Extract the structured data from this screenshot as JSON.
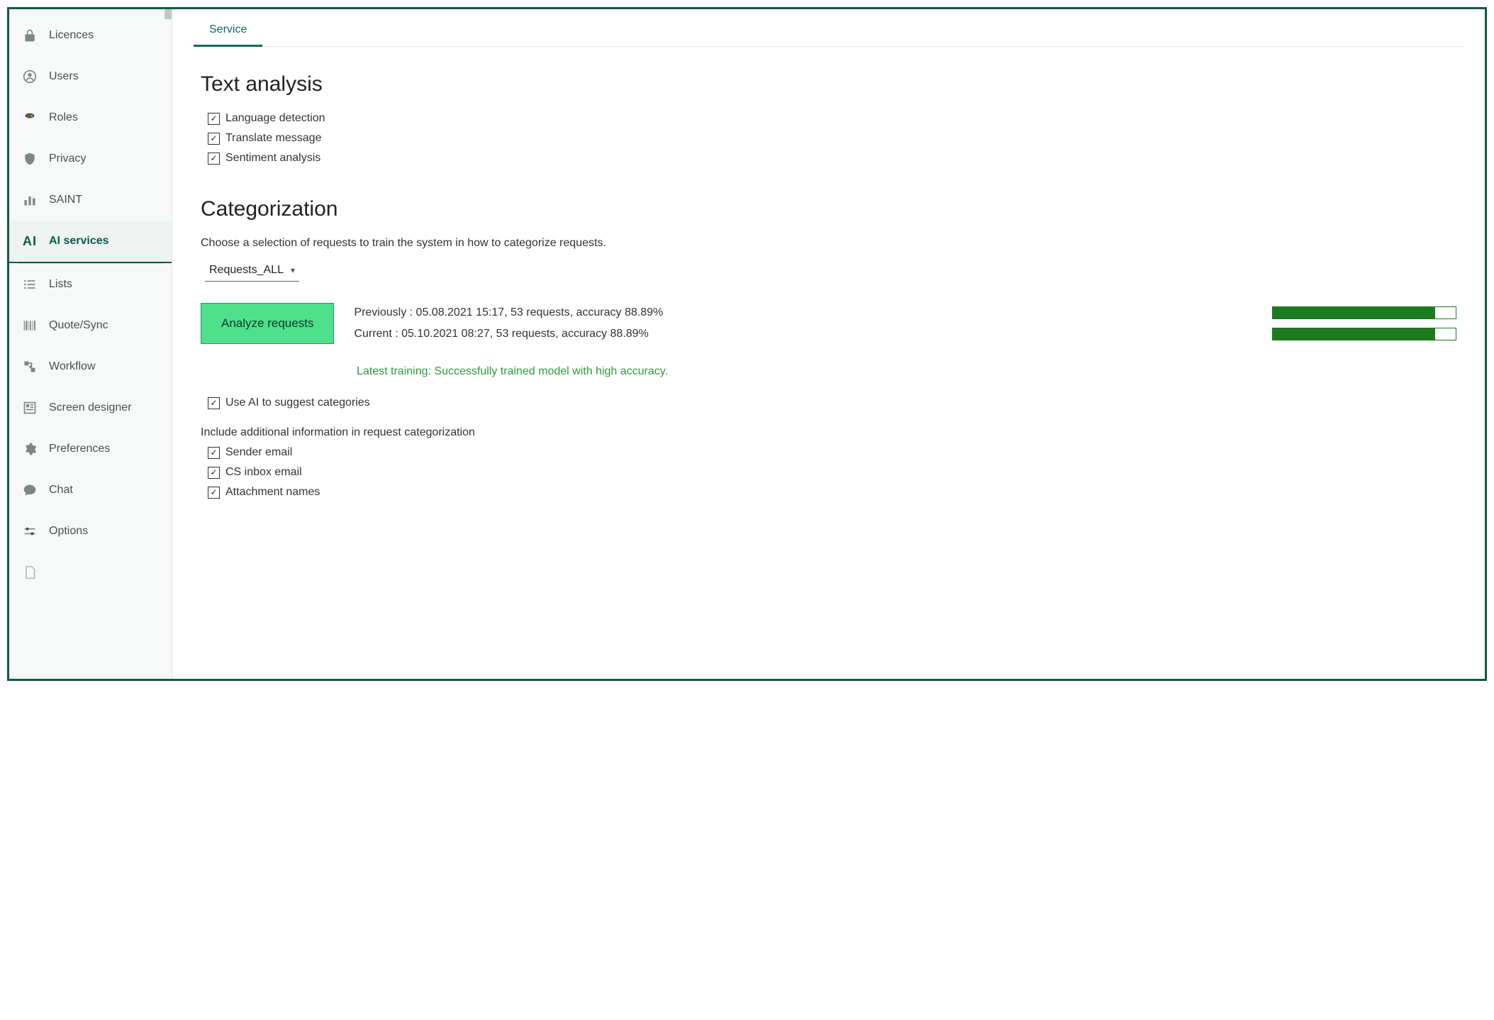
{
  "sidebar": {
    "items": [
      {
        "id": "licences",
        "label": "Licences"
      },
      {
        "id": "users",
        "label": "Users"
      },
      {
        "id": "roles",
        "label": "Roles"
      },
      {
        "id": "privacy",
        "label": "Privacy"
      },
      {
        "id": "saint",
        "label": "SAINT"
      },
      {
        "id": "ai",
        "label": "AI services"
      },
      {
        "id": "lists",
        "label": "Lists"
      },
      {
        "id": "quote",
        "label": "Quote/Sync"
      },
      {
        "id": "workflow",
        "label": "Workflow"
      },
      {
        "id": "screen",
        "label": "Screen designer"
      },
      {
        "id": "prefs",
        "label": "Preferences"
      },
      {
        "id": "chat",
        "label": "Chat"
      },
      {
        "id": "options",
        "label": "Options"
      }
    ],
    "ai_glyph": "AI"
  },
  "tabs": {
    "service": "Service"
  },
  "text_analysis": {
    "title": "Text analysis",
    "checks": {
      "lang": "Language detection",
      "translate": "Translate message",
      "sentiment": "Sentiment analysis"
    }
  },
  "categorization": {
    "title": "Categorization",
    "desc": "Choose a selection of requests to train the system in how to categorize requests.",
    "selection": "Requests_ALL",
    "analyze_label": "Analyze requests",
    "previous": "Previously : 05.08.2021 15:17, 53 requests, accuracy 88.89%",
    "current": "Current : 05.10.2021 08:27, 53 requests, accuracy 88.89%",
    "bar_prev_pct": 88.89,
    "bar_curr_pct": 88.89,
    "training_status": "Latest training: Successfully trained model with high accuracy.",
    "use_ai_suggest": "Use AI to suggest categories",
    "include_title": "Include additional information in request categorization",
    "include": {
      "sender": "Sender email",
      "csinbox": "CS inbox email",
      "attach": "Attachment names"
    }
  },
  "check_mark": "✓"
}
